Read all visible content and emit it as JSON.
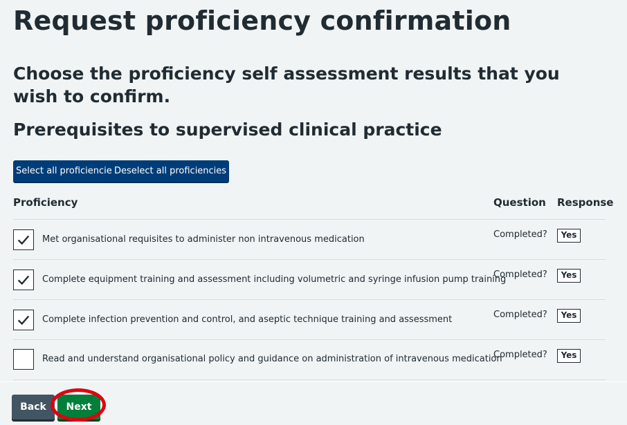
{
  "page": {
    "title": "Request proficiency confirmation",
    "subtitle": "Choose the proficiency self assessment results that you wish to confirm.",
    "section_title": "Prerequisites to supervised clinical practice"
  },
  "actions": {
    "select_all": "Select all proficiencies",
    "deselect_all": "Deselect all proficiencies"
  },
  "table": {
    "headers": {
      "proficiency": "Proficiency",
      "question": "Question",
      "response": "Response"
    },
    "rows": [
      {
        "checked": true,
        "label": "Met organisational requisites to administer non intravenous medication",
        "question": "Completed?",
        "response": "Yes"
      },
      {
        "checked": true,
        "label": "Complete equipment training and assessment including volumetric and syringe infusion pump training",
        "question": "Completed?",
        "response": "Yes"
      },
      {
        "checked": true,
        "label": "Complete infection prevention and control, and aseptic technique training and assessment",
        "question": "Completed?",
        "response": "Yes"
      },
      {
        "checked": false,
        "label": "Read and understand organisational policy and guidance on administration of intravenous medication",
        "question": "Completed?",
        "response": "Yes"
      }
    ]
  },
  "footer": {
    "back": "Back",
    "next": "Next"
  },
  "colors": {
    "primary_blue": "#003d78",
    "next_green": "#007f3b",
    "back_grey": "#425563",
    "highlight_red": "#e1000f"
  }
}
